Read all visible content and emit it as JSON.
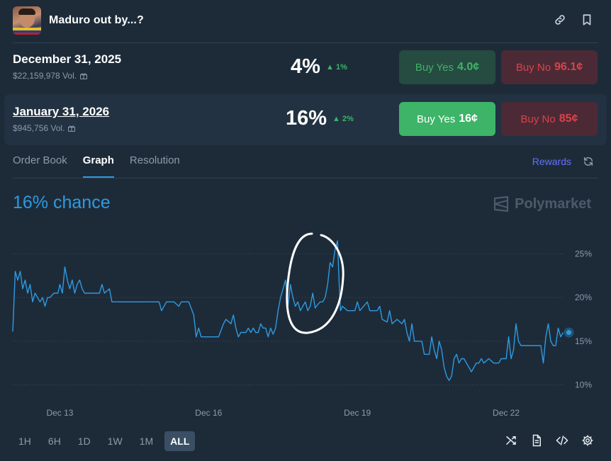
{
  "header": {
    "title": "Maduro out by...?",
    "icons": [
      "link-icon",
      "bookmark-icon"
    ]
  },
  "markets": [
    {
      "date": "December 31, 2025",
      "volume": "$22,159,978 Vol.",
      "percent": "4%",
      "change": "1%",
      "yes_label": "Buy Yes",
      "yes_price": "4.0¢",
      "no_label": "Buy No",
      "no_price": "96.1¢",
      "selected": false
    },
    {
      "date": "January 31, 2026",
      "volume": "$945,756 Vol.",
      "percent": "16%",
      "change": "2%",
      "yes_label": "Buy Yes",
      "yes_price": "16¢",
      "no_label": "Buy No",
      "no_price": "85¢",
      "selected": true
    }
  ],
  "tabs": [
    {
      "label": "Order Book",
      "active": false
    },
    {
      "label": "Graph",
      "active": true
    },
    {
      "label": "Resolution",
      "active": false
    }
  ],
  "rewards_label": "Rewards",
  "chance_label": "16% chance",
  "brand": "Polymarket",
  "chart_data": {
    "type": "line",
    "y_axis_ticks": [
      "25%",
      "20%",
      "15%",
      "10%"
    ],
    "y_tick_values": [
      25,
      20,
      15,
      10
    ],
    "x_axis_ticks": [
      "Dec 13",
      "Dec 16",
      "Dec 19",
      "Dec 22"
    ],
    "x_tick_values": [
      13,
      16,
      19,
      22
    ],
    "xlim": [
      12.05,
      23.2
    ],
    "ylim": [
      8.5,
      26.5
    ],
    "grid": "horizontal dotted",
    "current_value": 16,
    "series": [
      {
        "color": "#2e9ae0",
        "points": [
          [
            12.05,
            16.1
          ],
          [
            12.1,
            23.0
          ],
          [
            12.15,
            22.0
          ],
          [
            12.2,
            23.0
          ],
          [
            12.25,
            21.0
          ],
          [
            12.3,
            22.0
          ],
          [
            12.35,
            20.5
          ],
          [
            12.4,
            21.5
          ],
          [
            12.45,
            19.5
          ],
          [
            12.5,
            20.5
          ],
          [
            12.55,
            20.0
          ],
          [
            12.6,
            19.5
          ],
          [
            12.65,
            20.0
          ],
          [
            12.7,
            19.0
          ],
          [
            12.75,
            20.0
          ],
          [
            12.8,
            20.0
          ],
          [
            12.88,
            20.5
          ],
          [
            12.96,
            20.5
          ],
          [
            13.0,
            21.5
          ],
          [
            13.05,
            20.5
          ],
          [
            13.1,
            23.5
          ],
          [
            13.15,
            22.0
          ],
          [
            13.2,
            21.0
          ],
          [
            13.25,
            22.0
          ],
          [
            13.3,
            20.5
          ],
          [
            13.35,
            21.5
          ],
          [
            13.4,
            22.0
          ],
          [
            13.45,
            21.0
          ],
          [
            13.5,
            20.5
          ],
          [
            13.6,
            20.5
          ],
          [
            13.7,
            20.5
          ],
          [
            13.8,
            20.5
          ],
          [
            13.85,
            21.5
          ],
          [
            13.9,
            20.5
          ],
          [
            14.0,
            21.0
          ],
          [
            14.05,
            19.5
          ],
          [
            14.2,
            19.5
          ],
          [
            14.4,
            19.5
          ],
          [
            14.6,
            19.5
          ],
          [
            14.8,
            19.5
          ],
          [
            15.0,
            19.5
          ],
          [
            15.05,
            18.5
          ],
          [
            15.15,
            19.5
          ],
          [
            15.3,
            19.5
          ],
          [
            15.4,
            19.0
          ],
          [
            15.45,
            19.5
          ],
          [
            15.6,
            19.5
          ],
          [
            15.7,
            18.0
          ],
          [
            15.75,
            15.5
          ],
          [
            15.8,
            16.5
          ],
          [
            15.85,
            15.5
          ],
          [
            16.0,
            15.5
          ],
          [
            16.2,
            15.5
          ],
          [
            16.3,
            17.0
          ],
          [
            16.35,
            17.5
          ],
          [
            16.45,
            17.0
          ],
          [
            16.5,
            18.0
          ],
          [
            16.55,
            16.5
          ],
          [
            16.6,
            15.5
          ],
          [
            16.65,
            16.0
          ],
          [
            16.75,
            16.0
          ],
          [
            16.8,
            16.5
          ],
          [
            16.85,
            16.0
          ],
          [
            16.9,
            16.5
          ],
          [
            16.95,
            16.0
          ],
          [
            17.0,
            16.0
          ],
          [
            17.05,
            17.0
          ],
          [
            17.1,
            16.5
          ],
          [
            17.15,
            16.5
          ],
          [
            17.2,
            15.5
          ],
          [
            17.25,
            16.5
          ],
          [
            17.3,
            15.8
          ],
          [
            17.35,
            16.5
          ],
          [
            17.4,
            18.5
          ],
          [
            17.45,
            20.0
          ],
          [
            17.5,
            21.0
          ],
          [
            17.55,
            22.0
          ],
          [
            17.6,
            19.0
          ],
          [
            17.65,
            21.5
          ],
          [
            17.7,
            20.0
          ],
          [
            17.75,
            19.0
          ],
          [
            17.8,
            19.5
          ],
          [
            17.85,
            18.5
          ],
          [
            17.9,
            19.0
          ],
          [
            17.95,
            19.5
          ],
          [
            18.0,
            18.5
          ],
          [
            18.05,
            19.0
          ],
          [
            18.1,
            20.5
          ],
          [
            18.15,
            18.8
          ],
          [
            18.2,
            19.2
          ],
          [
            18.25,
            19.5
          ],
          [
            18.3,
            19.5
          ],
          [
            18.35,
            20.0
          ],
          [
            18.4,
            21.5
          ],
          [
            18.45,
            24.0
          ],
          [
            18.5,
            23.5
          ],
          [
            18.55,
            25.5
          ],
          [
            18.6,
            26.5
          ],
          [
            18.63,
            22.0
          ],
          [
            18.66,
            18.5
          ],
          [
            18.7,
            19.0
          ],
          [
            18.8,
            18.5
          ],
          [
            18.9,
            18.5
          ],
          [
            18.95,
            18.5
          ],
          [
            19.0,
            19.5
          ],
          [
            19.05,
            18.5
          ],
          [
            19.2,
            19.5
          ],
          [
            19.25,
            18.5
          ],
          [
            19.4,
            18.5
          ],
          [
            19.45,
            19.0
          ],
          [
            19.5,
            17.5
          ],
          [
            19.6,
            17.2
          ],
          [
            19.65,
            18.5
          ],
          [
            19.7,
            17.0
          ],
          [
            19.8,
            17.5
          ],
          [
            19.9,
            17.0
          ],
          [
            19.95,
            17.5
          ],
          [
            20.0,
            16.0
          ],
          [
            20.05,
            15.0
          ],
          [
            20.1,
            17.0
          ],
          [
            20.15,
            15.0
          ],
          [
            20.3,
            15.0
          ],
          [
            20.35,
            13.5
          ],
          [
            20.45,
            13.5
          ],
          [
            20.5,
            15.5
          ],
          [
            20.55,
            14.0
          ],
          [
            20.6,
            13.0
          ],
          [
            20.65,
            15.0
          ],
          [
            20.7,
            14.0
          ],
          [
            20.75,
            12.0
          ],
          [
            20.8,
            11.0
          ],
          [
            20.85,
            10.5
          ],
          [
            20.9,
            11.0
          ],
          [
            20.95,
            13.0
          ],
          [
            21.0,
            13.5
          ],
          [
            21.05,
            12.5
          ],
          [
            21.1,
            13.0
          ],
          [
            21.15,
            13.0
          ],
          [
            21.2,
            12.5
          ],
          [
            21.25,
            12.0
          ],
          [
            21.3,
            11.5
          ],
          [
            21.35,
            12.0
          ],
          [
            21.4,
            12.5
          ],
          [
            21.45,
            12.5
          ],
          [
            21.5,
            13.0
          ],
          [
            21.55,
            12.5
          ],
          [
            21.65,
            13.0
          ],
          [
            21.75,
            12.5
          ],
          [
            21.85,
            12.5
          ],
          [
            21.9,
            13.0
          ],
          [
            22.0,
            13.0
          ],
          [
            22.05,
            15.5
          ],
          [
            22.1,
            13.0
          ],
          [
            22.15,
            14.0
          ],
          [
            22.2,
            17.0
          ],
          [
            22.25,
            15.0
          ],
          [
            22.3,
            14.5
          ],
          [
            22.4,
            14.5
          ],
          [
            22.5,
            14.5
          ],
          [
            22.6,
            14.5
          ],
          [
            22.7,
            14.5
          ],
          [
            22.75,
            12.5
          ],
          [
            22.8,
            15.5
          ],
          [
            22.85,
            17.0
          ],
          [
            22.9,
            15.0
          ],
          [
            22.95,
            14.5
          ],
          [
            23.0,
            14.5
          ],
          [
            23.05,
            16.5
          ],
          [
            23.1,
            15.5
          ],
          [
            23.15,
            16.0
          ]
        ]
      }
    ]
  },
  "ranges": [
    {
      "label": "1H",
      "active": false
    },
    {
      "label": "6H",
      "active": false
    },
    {
      "label": "1D",
      "active": false
    },
    {
      "label": "1W",
      "active": false
    },
    {
      "label": "1M",
      "active": false
    },
    {
      "label": "ALL",
      "active": true
    }
  ],
  "colors": {
    "background": "#1d2b39",
    "accent_blue": "#2e9ae0",
    "yes_green": "#3db468",
    "no_red": "#d8434c"
  }
}
